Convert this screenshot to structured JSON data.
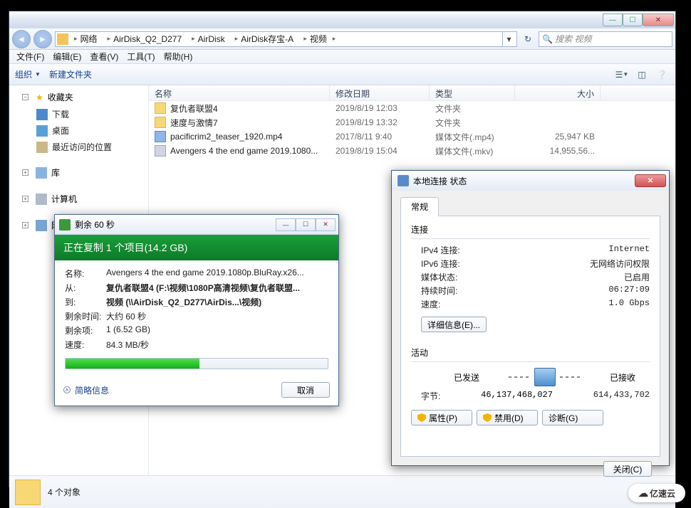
{
  "explorer": {
    "breadcrumb": [
      "网络",
      "AirDisk_Q2_D277",
      "AirDisk",
      "AirDisk存宝-A",
      "视频"
    ],
    "search_placeholder": "搜索 视频",
    "menubar": [
      "文件(F)",
      "编辑(E)",
      "查看(V)",
      "工具(T)",
      "帮助(H)"
    ],
    "toolbar": {
      "organize": "组织",
      "newfolder": "新建文件夹"
    },
    "sidebar": {
      "favorites": {
        "label": "收藏夹",
        "items": [
          "下载",
          "桌面",
          "最近访问的位置"
        ]
      },
      "libs": {
        "label": "库"
      },
      "computer": {
        "label": "计算机"
      },
      "network": {
        "label": "网络"
      }
    },
    "columns": {
      "name": "名称",
      "date": "修改日期",
      "type": "类型",
      "size": "大小"
    },
    "files": [
      {
        "icon": "folder",
        "name": "复仇者联盟4",
        "date": "2019/8/19 12:03",
        "type": "文件夹",
        "size": ""
      },
      {
        "icon": "folder",
        "name": "速度与激情7",
        "date": "2019/8/19 13:32",
        "type": "文件夹",
        "size": ""
      },
      {
        "icon": "mp4",
        "name": "pacificrim2_teaser_1920.mp4",
        "date": "2017/8/11 9:40",
        "type": "媒体文件(.mp4)",
        "size": "25,947 KB"
      },
      {
        "icon": "mkv",
        "name": "Avengers 4 the end game 2019.1080...",
        "date": "2019/8/19 15:04",
        "type": "媒体文件(.mkv)",
        "size": "14,955,56..."
      }
    ],
    "status": "4 个对象"
  },
  "copy": {
    "title": "剩余 60 秒",
    "banner": "正在复制 1 个项目(14.2 GB)",
    "labels": {
      "name": "名称:",
      "from": "从:",
      "to": "到:",
      "remain": "剩余时间:",
      "items": "剩余项:",
      "speed": "速度:"
    },
    "name": "Avengers 4 the end game 2019.1080p.BluRay.x26...",
    "from": "复仇者联盟4 (F:\\视频\\1080P高清视频\\复仇者联盟...",
    "to": "视频 (\\\\AirDisk_Q2_D277\\AirDis...\\视频)",
    "remain": "大约 60 秒",
    "items": "1 (6.52 GB)",
    "speed": "84.3 MB/秒",
    "progress_pct": 51,
    "more": "简略信息",
    "cancel": "取消"
  },
  "net": {
    "title": "本地连接 状态",
    "tab": "常规",
    "conn_title": "连接",
    "conn": [
      {
        "k": "IPv4 连接:",
        "v": "Internet"
      },
      {
        "k": "IPv6 连接:",
        "v": "无网络访问权限"
      },
      {
        "k": "媒体状态:",
        "v": "已启用"
      },
      {
        "k": "持续时间:",
        "v": "06:27:09"
      },
      {
        "k": "速度:",
        "v": "1.0 Gbps"
      }
    ],
    "details_btn": "详细信息(E)...",
    "activity_title": "活动",
    "sent_label": "已发送",
    "recv_label": "已接收",
    "bytes_label": "字节:",
    "bytes_sent": "46,137,468,027",
    "bytes_recv": "614,433,702",
    "btn_props": "属性(P)",
    "btn_disable": "禁用(D)",
    "btn_diag": "诊断(G)",
    "btn_close": "关闭(C)"
  },
  "watermark": "亿速云"
}
